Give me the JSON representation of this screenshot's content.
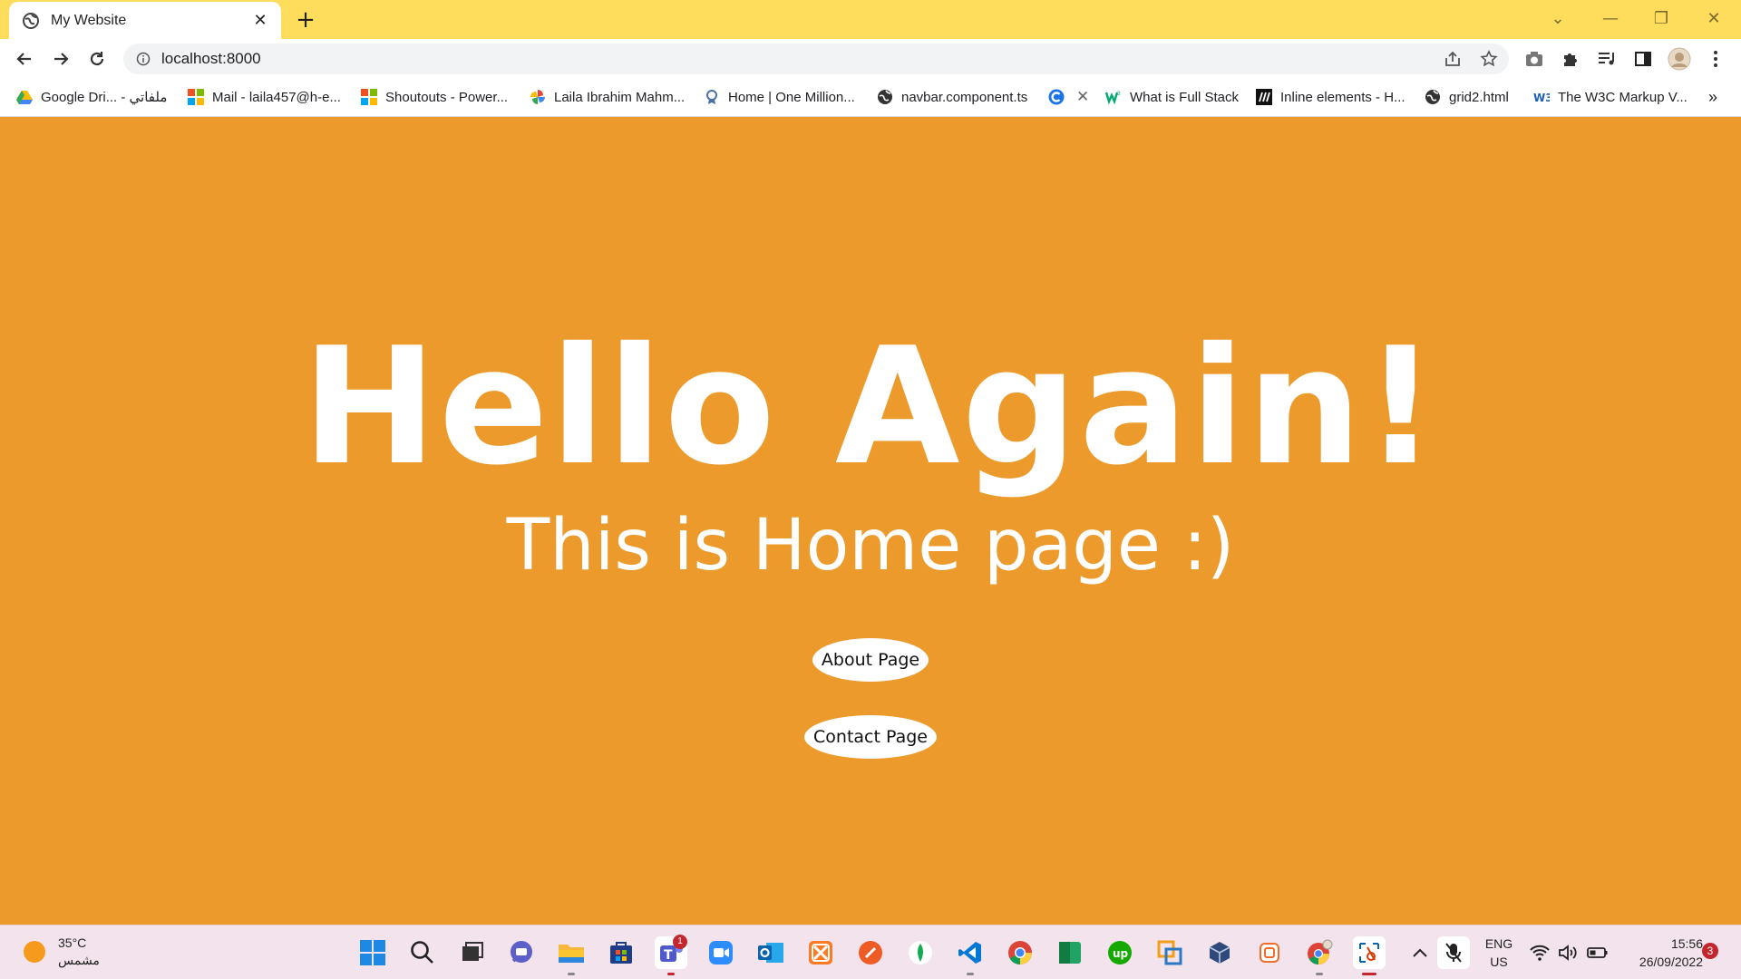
{
  "browser": {
    "tab_title": "My Website",
    "tab_close": "✕",
    "new_tab": "+",
    "url": "localhost:8000",
    "window_controls": {
      "minimize": "—",
      "restore": "❐",
      "close": "✕",
      "tab_search": "⌄"
    }
  },
  "bookmarks": [
    {
      "label": "Google Dri... - ملفاتي",
      "icon": "google-drive-icon"
    },
    {
      "label": "Mail - laila457@h-e...",
      "icon": "microsoft-icon"
    },
    {
      "label": "Shoutouts - Power...",
      "icon": "microsoft-icon"
    },
    {
      "label": "Laila Ibrahim Mahm...",
      "icon": "pinwheel-icon"
    },
    {
      "label": "Home | One Million...",
      "icon": "badge-icon"
    },
    {
      "label": "navbar.component.ts",
      "icon": "globe-icon"
    },
    {
      "label": "",
      "icon": "c-logo-icon"
    },
    {
      "label": "What is Full Stack",
      "icon": "w3-icon"
    },
    {
      "label": "Inline elements - H...",
      "icon": "mdn-icon"
    },
    {
      "label": "grid2.html",
      "icon": "globe-icon"
    },
    {
      "label": "The W3C Markup V...",
      "icon": "w3c-icon"
    }
  ],
  "bookmarks_more": "»",
  "page": {
    "heading": "Hello Again!",
    "subheading": "This is Home page :)",
    "about_button": "About Page",
    "contact_button": "Contact Page",
    "background_color": "#ED9A2D"
  },
  "taskbar": {
    "weather_temp": "35°C",
    "weather_desc": "مشمس",
    "teams_badge": "1",
    "language": "ENG",
    "region": "US",
    "time": "15:56",
    "date": "26/09/2022",
    "notification_count": "3"
  }
}
